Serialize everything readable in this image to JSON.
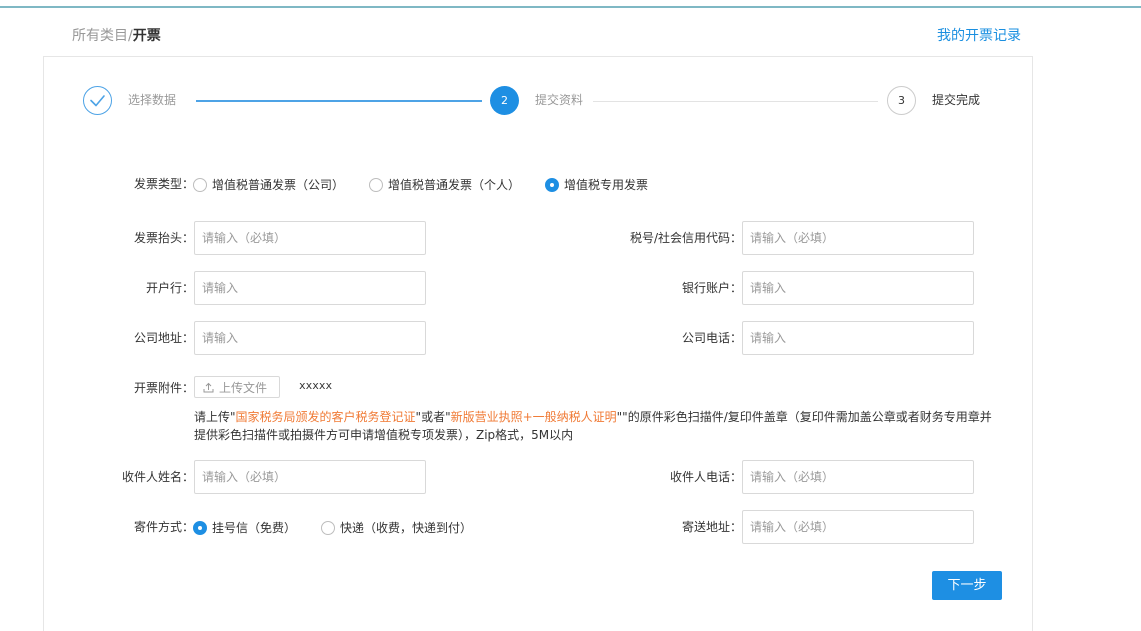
{
  "breadcrumb": {
    "root": "所有类目",
    "separator": "/",
    "current": "开票"
  },
  "header": {
    "records_link": "我的开票记录"
  },
  "steps": [
    {
      "number": "",
      "label": "选择数据",
      "state": "done"
    },
    {
      "number": "2",
      "label": "提交资料",
      "state": "active"
    },
    {
      "number": "3",
      "label": "提交完成",
      "state": "todo"
    }
  ],
  "form": {
    "invoice_type": {
      "label": "发票类型：",
      "options": [
        {
          "label": "增值税普通发票（公司）",
          "selected": false
        },
        {
          "label": "增值税普通发票（个人）",
          "selected": false
        },
        {
          "label": "增值税专用发票",
          "selected": true
        }
      ]
    },
    "invoice_title": {
      "label": "发票抬头：",
      "placeholder": "请输入（必填）",
      "value": ""
    },
    "tax_id": {
      "label": "税号/社会信用代码：",
      "placeholder": "请输入（必填）",
      "value": ""
    },
    "bank": {
      "label": "开户行：",
      "placeholder": "请输入",
      "value": ""
    },
    "bank_account": {
      "label": "银行账户：",
      "placeholder": "请输入",
      "value": ""
    },
    "company_address": {
      "label": "公司地址：",
      "placeholder": "请输入",
      "value": ""
    },
    "company_phone": {
      "label": "公司电话：",
      "placeholder": "请输入",
      "value": ""
    },
    "attachment": {
      "label": "开票附件：",
      "upload_label": "上传文件",
      "file_name": "xxxxx",
      "note": {
        "prefix": "请上传\"",
        "link1": "国家税务局颁发的客户税务登记证",
        "middle": "\"或者\"",
        "link2": "新版营业执照+一般纳税人证明",
        "suffix": "\"\"的原件彩色扫描件/复印件盖章（复印件需加盖公章或者财务专用章并提供彩色扫描件或拍摄件方可申请增值税专项发票），Zip格式，5M以内"
      }
    },
    "recipient_name": {
      "label": "收件人姓名：",
      "placeholder": "请输入（必填）",
      "value": ""
    },
    "recipient_phone": {
      "label": "收件人电话：",
      "placeholder": "请输入（必填）",
      "value": ""
    },
    "shipping_method": {
      "label": "寄件方式：",
      "options": [
        {
          "label": "挂号信（免费）",
          "selected": true
        },
        {
          "label": "快递（收费，快递到付）",
          "selected": false
        }
      ]
    },
    "shipping_address": {
      "label": "寄送地址：",
      "placeholder": "请输入（必填）",
      "value": ""
    }
  },
  "actions": {
    "next_label": "下一步"
  },
  "colors": {
    "accent": "#1e8fe3",
    "highlight": "#f07a35",
    "top_line": "#7fb8c4"
  }
}
